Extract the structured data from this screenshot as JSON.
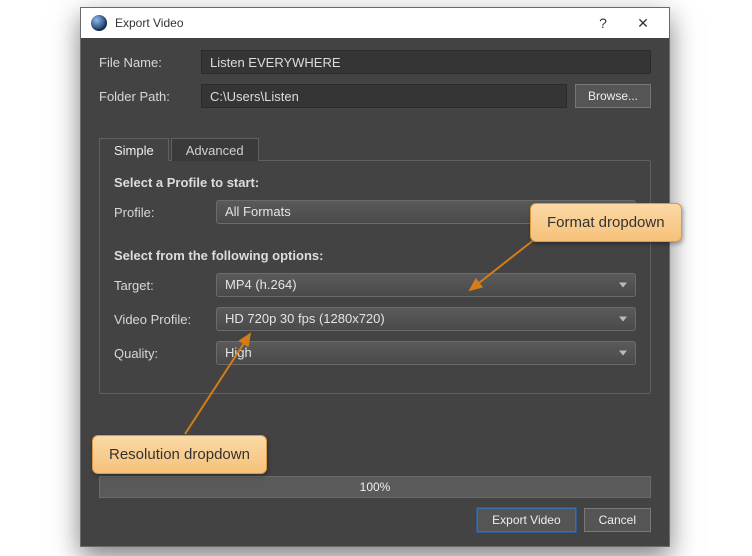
{
  "titlebar": {
    "title": "Export Video",
    "help_symbol": "?",
    "close_symbol": "✕"
  },
  "fields": {
    "file_name_label": "File Name:",
    "file_name_value": "Listen EVERYWHERE",
    "folder_path_label": "Folder Path:",
    "folder_path_value": "C:\\Users\\Listen",
    "browse_button": "Browse..."
  },
  "tabs": {
    "simple": "Simple",
    "advanced": "Advanced"
  },
  "profile_section": {
    "title": "Select a Profile to start:",
    "profile_label": "Profile:",
    "profile_value": "All Formats"
  },
  "options_section": {
    "title": "Select from the following options:",
    "target_label": "Target:",
    "target_value": "MP4 (h.264)",
    "video_profile_label": "Video Profile:",
    "video_profile_value": "HD 720p 30 fps (1280x720)",
    "quality_label": "Quality:",
    "quality_value": "High"
  },
  "progress": {
    "text": "100%"
  },
  "footer": {
    "export_button": "Export Video",
    "cancel_button": "Cancel"
  },
  "annotations": {
    "format": "Format dropdown",
    "resolution": "Resolution dropdown"
  }
}
